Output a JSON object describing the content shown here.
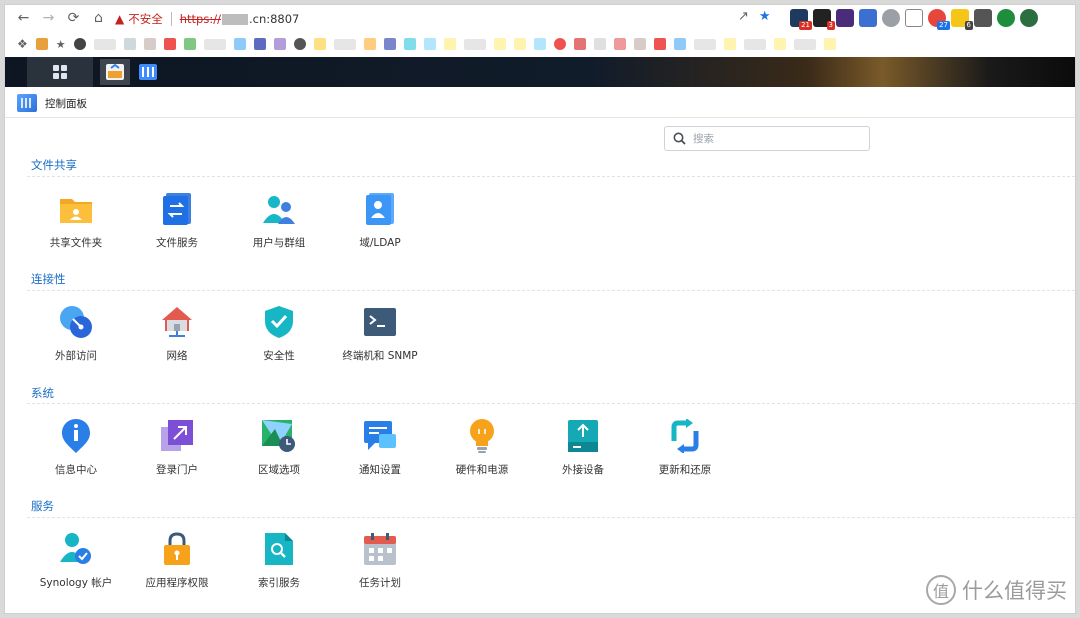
{
  "browser": {
    "insecure_label": "不安全",
    "url_scheme": "https://",
    "url_host_suffix": ".cn:8807",
    "extension_badges": [
      "21",
      "3",
      "27",
      "6"
    ],
    "colors": {
      "warning": "#c5221f",
      "accent": "#1a73e8"
    }
  },
  "window": {
    "title": "控制面板"
  },
  "search": {
    "placeholder": "搜索"
  },
  "sections": [
    {
      "title": "文件共享",
      "items": [
        {
          "label": "共享文件夹",
          "icon": "shared-folder-icon"
        },
        {
          "label": "文件服务",
          "icon": "file-services-icon"
        },
        {
          "label": "用户与群组",
          "icon": "user-group-icon"
        },
        {
          "label": "域/LDAP",
          "icon": "domain-ldap-icon"
        }
      ]
    },
    {
      "title": "连接性",
      "items": [
        {
          "label": "外部访问",
          "icon": "external-access-icon"
        },
        {
          "label": "网络",
          "icon": "network-icon"
        },
        {
          "label": "安全性",
          "icon": "security-shield-icon"
        },
        {
          "label": "终端机和 SNMP",
          "icon": "terminal-icon"
        }
      ]
    },
    {
      "title": "系统",
      "items": [
        {
          "label": "信息中心",
          "icon": "info-center-icon"
        },
        {
          "label": "登录门户",
          "icon": "login-portal-icon"
        },
        {
          "label": "区域选项",
          "icon": "regional-options-icon"
        },
        {
          "label": "通知设置",
          "icon": "notification-icon"
        },
        {
          "label": "硬件和电源",
          "icon": "hardware-power-icon"
        },
        {
          "label": "外接设备",
          "icon": "external-devices-icon"
        },
        {
          "label": "更新和还原",
          "icon": "update-restore-icon"
        }
      ]
    },
    {
      "title": "服务",
      "items": [
        {
          "label": "Synology 帐户",
          "icon": "synology-account-icon"
        },
        {
          "label": "应用程序权限",
          "icon": "app-privileges-icon"
        },
        {
          "label": "索引服务",
          "icon": "indexing-service-icon"
        },
        {
          "label": "任务计划",
          "icon": "task-scheduler-icon"
        }
      ]
    }
  ],
  "watermark": {
    "logo_char": "值",
    "text": "什么值得买"
  }
}
